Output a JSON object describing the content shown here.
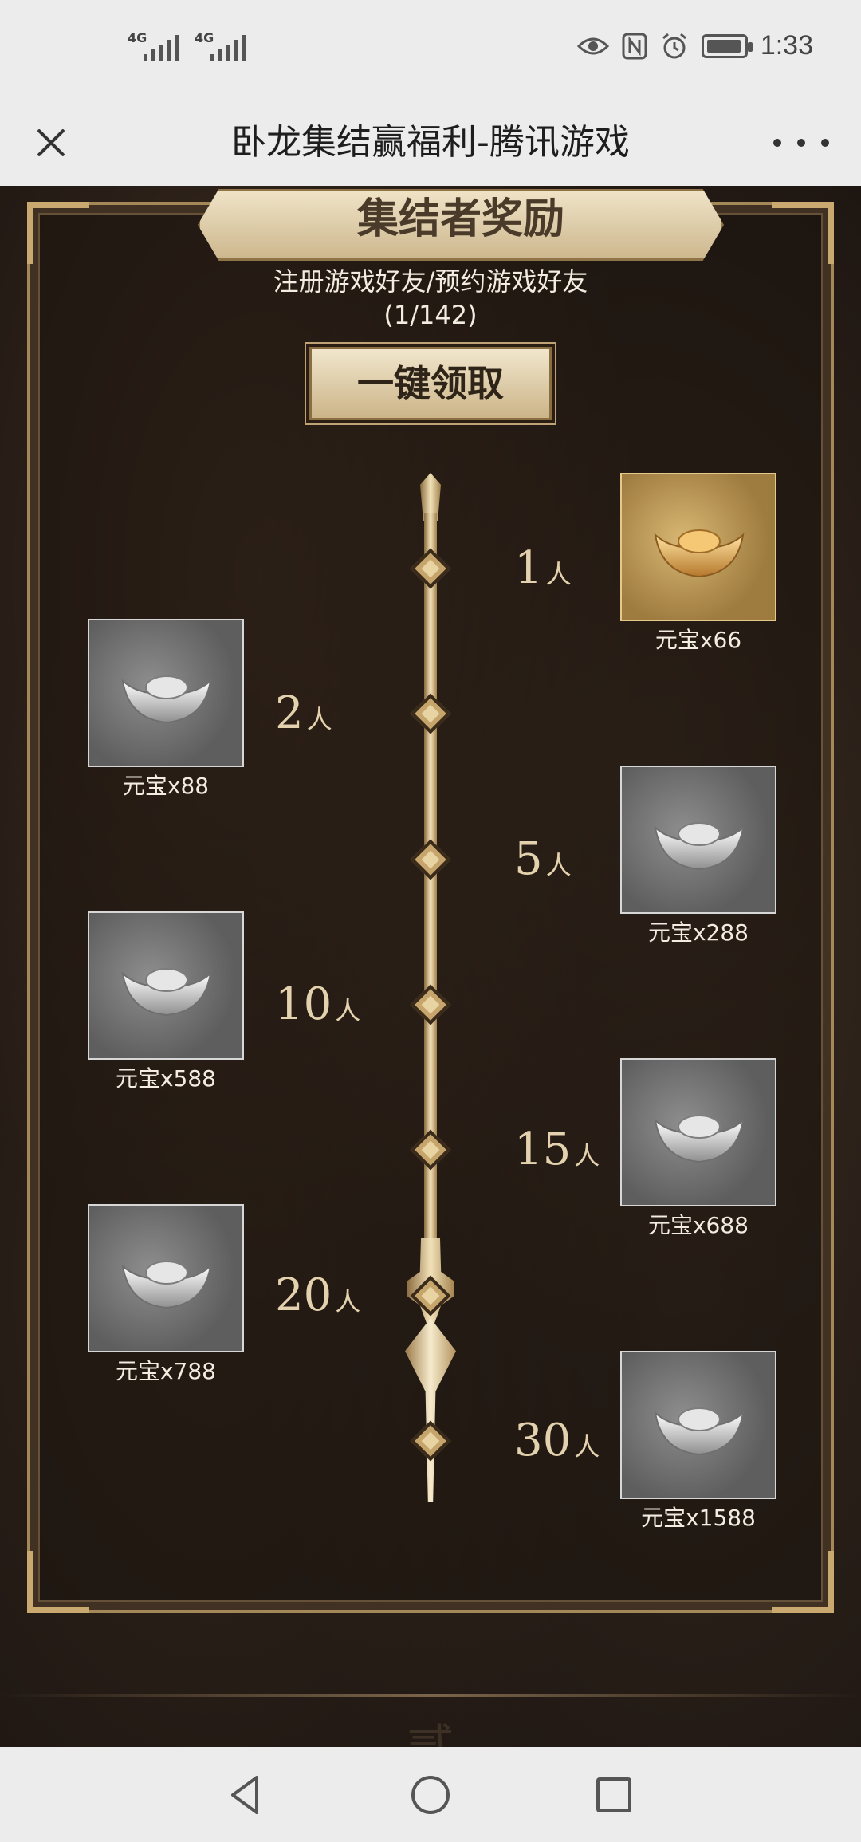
{
  "status_bar": {
    "signal_1": "4G",
    "signal_2": "4G",
    "time": "1:33"
  },
  "title_bar": {
    "title": "卧龙集结赢福利-腾讯游戏"
  },
  "section": {
    "banner": "集结者奖励",
    "subtitle_line1": "注册游戏好友/预约游戏好友",
    "subtitle_line2": "(1/142)",
    "claim_button": "一键领取"
  },
  "tiers": [
    {
      "count": "1",
      "unit": "人",
      "reward": "元宝x66",
      "color": "gold"
    },
    {
      "count": "2",
      "unit": "人",
      "reward": "元宝x88",
      "color": "silver"
    },
    {
      "count": "5",
      "unit": "人",
      "reward": "元宝x288",
      "color": "silver"
    },
    {
      "count": "10",
      "unit": "人",
      "reward": "元宝x588",
      "color": "silver"
    },
    {
      "count": "15",
      "unit": "人",
      "reward": "元宝x688",
      "color": "silver"
    },
    {
      "count": "20",
      "unit": "人",
      "reward": "元宝x788",
      "color": "silver"
    },
    {
      "count": "30",
      "unit": "人",
      "reward": "元宝x1588",
      "color": "silver"
    }
  ],
  "footer_glyph": "贰",
  "colors": {
    "accent_gold": "#caa970",
    "panel_border": "#a58858",
    "text_light": "#f3ece0"
  }
}
